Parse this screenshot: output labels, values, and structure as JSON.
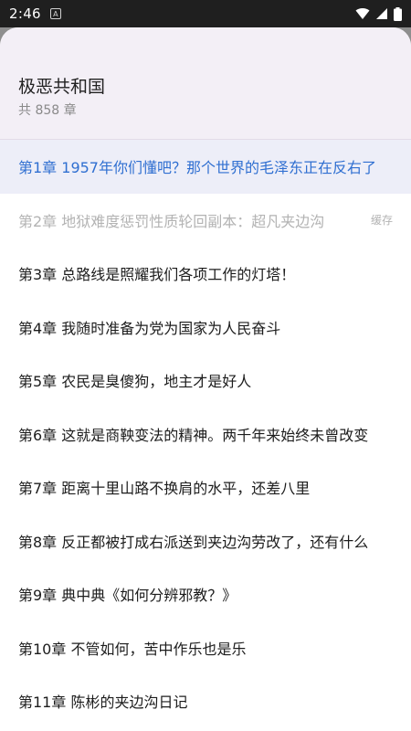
{
  "status_bar": {
    "time": "2:46",
    "icons": [
      "notification-a-icon",
      "wifi-icon",
      "signal-icon",
      "battery-icon"
    ]
  },
  "header": {
    "title": "极恶共和国",
    "count": "共 858 章"
  },
  "chapters": [
    {
      "title": "第1章 1957年你们懂吧？那个世界的毛泽东正在反右了"
    },
    {
      "title": "第2章 地狱难度惩罚性质轮回副本：超凡夹边沟",
      "tag": "缓存"
    },
    {
      "title": "第3章 总路线是照耀我们各项工作的灯塔！"
    },
    {
      "title": "第4章 我随时准备为党为国家为人民奋斗"
    },
    {
      "title": "第5章 农民是臭傻狗，地主才是好人"
    },
    {
      "title": "第6章 这就是商鞅变法的精神。两千年来始终未曾改变"
    },
    {
      "title": "第7章 距离十里山路不换肩的水平，还差八里"
    },
    {
      "title": "第8章 反正都被打成右派送到夹边沟劳改了，还有什么"
    },
    {
      "title": "第9章 典中典《如何分辨邪教？》"
    },
    {
      "title": "第10章 不管如何，苦中作乐也是乐"
    },
    {
      "title": "第11章 陈彬的夹边沟日记"
    }
  ],
  "colors": {
    "accent": "#2f6fd1",
    "header_bg": "#f3eff6",
    "current_bg": "#edeef8",
    "muted": "#b3b3b3"
  }
}
